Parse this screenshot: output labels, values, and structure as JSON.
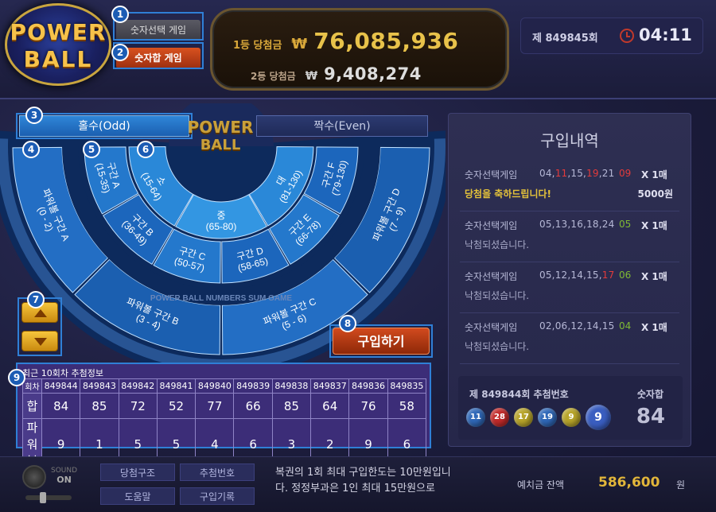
{
  "logo": {
    "line1": "POWER",
    "line2": "BALL"
  },
  "modes": {
    "select_game": "숫자선택 게임",
    "sum_game": "숫자합 게임"
  },
  "jackpot": {
    "first_label": "1등 당첨금",
    "first_currency": "₩",
    "first_amount": "76,085,936",
    "second_label": "2등 당첨금",
    "second_currency": "₩",
    "second_amount": "9,408,274"
  },
  "round": {
    "label": "제 849845회",
    "time": "04:11"
  },
  "board": {
    "odd_label": "홀수(Odd)",
    "even_label": "짝수(Even)",
    "center_line1": "POWER",
    "center_line2": "BALL",
    "ring_text": "POWER BALL NUMBERS SUM GAME",
    "powerball_zones": [
      {
        "name": "파워볼 구간 A",
        "range": "(0 - 2)"
      },
      {
        "name": "파워볼 구간 B",
        "range": "(3 - 4)"
      },
      {
        "name": "파워볼 구간 C",
        "range": "(5 - 6)"
      },
      {
        "name": "파워볼 구간 D",
        "range": "(7 - 9)"
      }
    ],
    "size_zones": [
      {
        "name": "소",
        "range": "(15-64)"
      },
      {
        "name": "중",
        "range": "(65-80)"
      },
      {
        "name": "대",
        "range": "(81-130)"
      }
    ],
    "sum_zones": [
      {
        "name": "구간 A",
        "range": "(15-35)"
      },
      {
        "name": "구간 B",
        "range": "(36-49)"
      },
      {
        "name": "구간 C",
        "range": "(50-57)"
      },
      {
        "name": "구간 D",
        "range": "(58-65)"
      },
      {
        "name": "구간 E",
        "range": "(66-78)"
      },
      {
        "name": "구간 F",
        "range": "(79-130)"
      }
    ],
    "buy_label": "구입하기"
  },
  "badges": [
    "1",
    "2",
    "3",
    "4",
    "5",
    "6",
    "7",
    "8",
    "9"
  ],
  "history": {
    "title": "최근 10회차 추첨정보",
    "row_labels": [
      "회차",
      "합",
      "파워볼"
    ],
    "rounds": [
      "849844",
      "849843",
      "849842",
      "849841",
      "849840",
      "849839",
      "849838",
      "849837",
      "849836",
      "849835"
    ],
    "sums": [
      "84",
      "85",
      "72",
      "52",
      "77",
      "66",
      "85",
      "64",
      "76",
      "58"
    ],
    "powerballs": [
      "9",
      "1",
      "5",
      "5",
      "4",
      "6",
      "3",
      "2",
      "9",
      "6"
    ]
  },
  "purchase": {
    "title": "구입내역",
    "entries": [
      {
        "game": "숫자선택게임",
        "nums": [
          "04",
          "11",
          "15",
          "19",
          "21"
        ],
        "hi": [
          false,
          true,
          false,
          true,
          false
        ],
        "pb": "09",
        "pb_red": true,
        "qty": "X 1매",
        "status": "당첨을 축하드립니다!",
        "win": true,
        "prize": "5000원"
      },
      {
        "game": "숫자선택게임",
        "nums": [
          "05",
          "13",
          "16",
          "18",
          "24"
        ],
        "hi": [
          false,
          false,
          false,
          false,
          false
        ],
        "pb": "05",
        "pb_red": false,
        "qty": "X 1매",
        "status": "낙첨되셨습니다.",
        "win": false,
        "prize": ""
      },
      {
        "game": "숫자선택게임",
        "nums": [
          "05",
          "12",
          "14",
          "15",
          "17"
        ],
        "hi": [
          false,
          false,
          false,
          false,
          true
        ],
        "pb": "06",
        "pb_red": false,
        "qty": "X 1매",
        "status": "낙첨되셨습니다.",
        "win": false,
        "prize": ""
      },
      {
        "game": "숫자선택게임",
        "nums": [
          "02",
          "06",
          "12",
          "14",
          "15"
        ],
        "hi": [
          false,
          false,
          false,
          false,
          false
        ],
        "pb": "04",
        "pb_red": false,
        "qty": "X 1매",
        "status": "낙첨되셨습니다.",
        "win": false,
        "prize": ""
      }
    ],
    "result_label": "제 849844회 추첨번호",
    "sum_label": "숫자합",
    "sum_value": "84",
    "balls": [
      {
        "n": "11",
        "color": "#2f68b8"
      },
      {
        "n": "28",
        "color": "#c22a2a"
      },
      {
        "n": "17",
        "color": "#b7a42a"
      },
      {
        "n": "19",
        "color": "#2f68b8"
      },
      {
        "n": "9",
        "color": "#b7a42a"
      }
    ],
    "power_ball": {
      "n": "9",
      "color": "#3a5ec0"
    }
  },
  "footer": {
    "sound_label_1": "SOUND",
    "sound_label_2": "ON",
    "buttons": [
      "당첨구조",
      "추첨번호",
      "도움말",
      "구입기록"
    ],
    "notice": "복권의 1회 최대 구입한도는 10만원입니다. 정정부과은 1인 최대 15만원으로",
    "balance_label": "예치금 잔액",
    "balance_value": "586,600",
    "balance_unit": "원"
  },
  "colors": {
    "accent": "#2f7fd6",
    "gold": "#e8c24a",
    "buy": "#d14a1e"
  }
}
